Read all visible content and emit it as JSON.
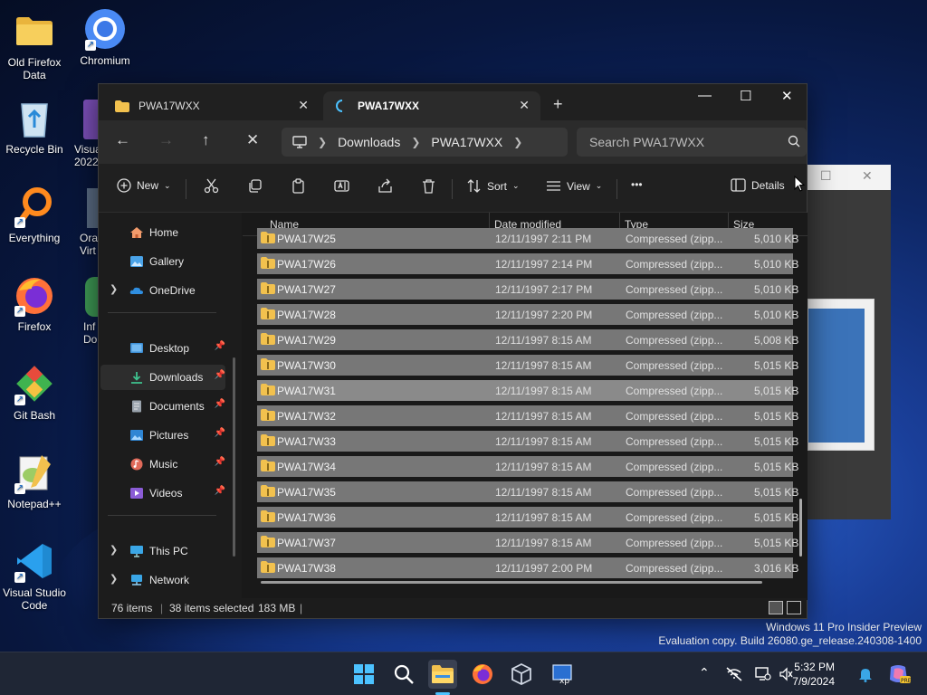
{
  "desktop": {
    "icons": [
      {
        "label_l1": "Old Firefox",
        "label_l2": "Data",
        "icon": "folder-icon"
      },
      {
        "label_l1": "Chromium",
        "label_l2": "",
        "icon": "chromium-icon"
      },
      {
        "label_l1": "Recycle Bin",
        "label_l2": "",
        "icon": "recycle-bin-icon"
      },
      {
        "label_l1": "Visua",
        "label_l2": "2022",
        "icon": "visual-studio-icon"
      },
      {
        "label_l1": "Everything",
        "label_l2": "",
        "icon": "everything-icon"
      },
      {
        "label_l1": "Ora",
        "label_l2": "Virt",
        "icon": "virtualbox-icon"
      },
      {
        "label_l1": "Firefox",
        "label_l2": "",
        "icon": "firefox-icon"
      },
      {
        "label_l1": "Inf",
        "label_l2": "Do",
        "icon": "app-icon"
      },
      {
        "label_l1": "Git Bash",
        "label_l2": "",
        "icon": "git-bash-icon"
      },
      {
        "label_l1": "Notepad++",
        "label_l2": "",
        "icon": "notepadpp-icon"
      },
      {
        "label_l1": "Visual Studio",
        "label_l2": "Code",
        "icon": "vscode-icon"
      }
    ]
  },
  "explorer": {
    "tabs": [
      {
        "label": "PWA17WXX",
        "icon": "folder-icon",
        "active": false
      },
      {
        "label": "PWA17WXX",
        "icon": "loading-icon",
        "active": true
      }
    ],
    "window_controls": {
      "minimize": "—",
      "maximize": "☐",
      "close": "✕"
    },
    "address": {
      "parts": [
        "Downloads",
        "PWA17WXX"
      ]
    },
    "search": {
      "placeholder": "Search PWA17WXX"
    },
    "toolbar": {
      "new_label": "New",
      "sort_label": "Sort",
      "view_label": "View",
      "more_label": "•••",
      "details_label": "Details"
    },
    "sidebar": {
      "home": "Home",
      "gallery": "Gallery",
      "onedrive": "OneDrive",
      "desktop": "Desktop",
      "downloads": "Downloads",
      "documents": "Documents",
      "pictures": "Pictures",
      "music": "Music",
      "videos": "Videos",
      "thispc": "This PC",
      "network": "Network"
    },
    "columns": {
      "name": "Name",
      "date": "Date modified",
      "type": "Type",
      "size": "Size"
    },
    "rows": [
      {
        "name": "PWA17W25",
        "date": "12/11/1997 2:11 PM",
        "type": "Compressed (zipp...",
        "size": "5,010 KB"
      },
      {
        "name": "PWA17W26",
        "date": "12/11/1997 2:14 PM",
        "type": "Compressed (zipp...",
        "size": "5,010 KB"
      },
      {
        "name": "PWA17W27",
        "date": "12/11/1997 2:17 PM",
        "type": "Compressed (zipp...",
        "size": "5,010 KB"
      },
      {
        "name": "PWA17W28",
        "date": "12/11/1997 2:20 PM",
        "type": "Compressed (zipp...",
        "size": "5,010 KB"
      },
      {
        "name": "PWA17W29",
        "date": "12/11/1997 8:15 AM",
        "type": "Compressed (zipp...",
        "size": "5,008 KB"
      },
      {
        "name": "PWA17W30",
        "date": "12/11/1997 8:15 AM",
        "type": "Compressed (zipp...",
        "size": "5,015 KB"
      },
      {
        "name": "PWA17W31",
        "date": "12/11/1997 8:15 AM",
        "type": "Compressed (zipp...",
        "size": "5,015 KB"
      },
      {
        "name": "PWA17W32",
        "date": "12/11/1997 8:15 AM",
        "type": "Compressed (zipp...",
        "size": "5,015 KB"
      },
      {
        "name": "PWA17W33",
        "date": "12/11/1997 8:15 AM",
        "type": "Compressed (zipp...",
        "size": "5,015 KB"
      },
      {
        "name": "PWA17W34",
        "date": "12/11/1997 8:15 AM",
        "type": "Compressed (zipp...",
        "size": "5,015 KB"
      },
      {
        "name": "PWA17W35",
        "date": "12/11/1997 8:15 AM",
        "type": "Compressed (zipp...",
        "size": "5,015 KB"
      },
      {
        "name": "PWA17W36",
        "date": "12/11/1997 8:15 AM",
        "type": "Compressed (zipp...",
        "size": "5,015 KB"
      },
      {
        "name": "PWA17W37",
        "date": "12/11/1997 8:15 AM",
        "type": "Compressed (zipp...",
        "size": "5,015 KB"
      },
      {
        "name": "PWA17W38",
        "date": "12/11/1997 2:00 PM",
        "type": "Compressed (zipp...",
        "size": "3,016 KB"
      }
    ],
    "status": {
      "items": "76 items",
      "selected": "38 items selected",
      "size": "183 MB",
      "sep": "|"
    }
  },
  "watermark": {
    "line1": "Windows 11 Pro Insider Preview",
    "line2": "Evaluation copy. Build 26080.ge_release.240308-1400"
  },
  "taskbar": {
    "icons": [
      "start-icon",
      "search-icon",
      "file-explorer-icon",
      "firefox-icon",
      "virtualbox-icon",
      "xp-mode-icon"
    ],
    "time": "5:32 PM",
    "date": "7/9/2024"
  },
  "colors": {
    "selection_row": "#777777",
    "hover_row": "#8a8a8a",
    "window_bg": "#191919",
    "accent": "#4cc2ff",
    "folder": "#f2c14e"
  }
}
